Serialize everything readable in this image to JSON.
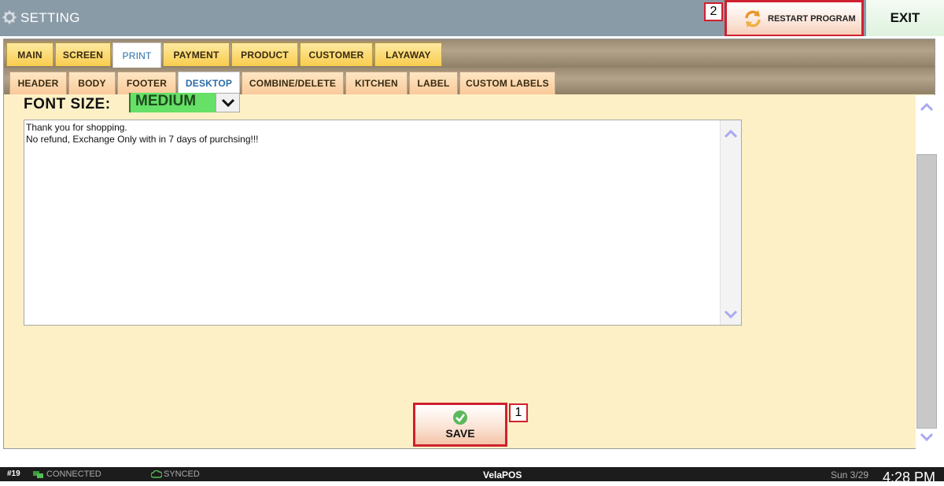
{
  "window": {
    "title": "SETTING",
    "restart_label": "RESTART PROGRAM",
    "exit_label": "EXIT"
  },
  "markers": {
    "one": "1",
    "two": "2"
  },
  "main_tabs": [
    "MAIN",
    "SCREEN",
    "PRINT",
    "PAYMENT",
    "PRODUCT",
    "CUSTOMER",
    "LAYAWAY"
  ],
  "main_tab_active": "PRINT",
  "sub_tabs": [
    "HEADER",
    "BODY",
    "FOOTER",
    "DESKTOP",
    "COMBINE/DELETE",
    "KITCHEN",
    "LABEL",
    "CUSTOM LABELS"
  ],
  "sub_tab_active": "DESKTOP",
  "font_size": {
    "label": "FONT SIZE:",
    "value": "MEDIUM"
  },
  "footer_text": "Thank you for shopping.\nNo refund, Exchange Only with in 7 days of purchsing!!!",
  "save_label": "SAVE",
  "status": {
    "terminal": "#19",
    "connection": "CONNECTED",
    "sync": "SYNCED",
    "brand": "VelaPOS",
    "date": "Sun 3/29",
    "time": "4:28 PM"
  },
  "colors": {
    "titlebar": "#8a9ba8",
    "panel_bg": "#fdf0c6",
    "font_value_bg": "#66e066",
    "highlight_border": "#d02030"
  }
}
